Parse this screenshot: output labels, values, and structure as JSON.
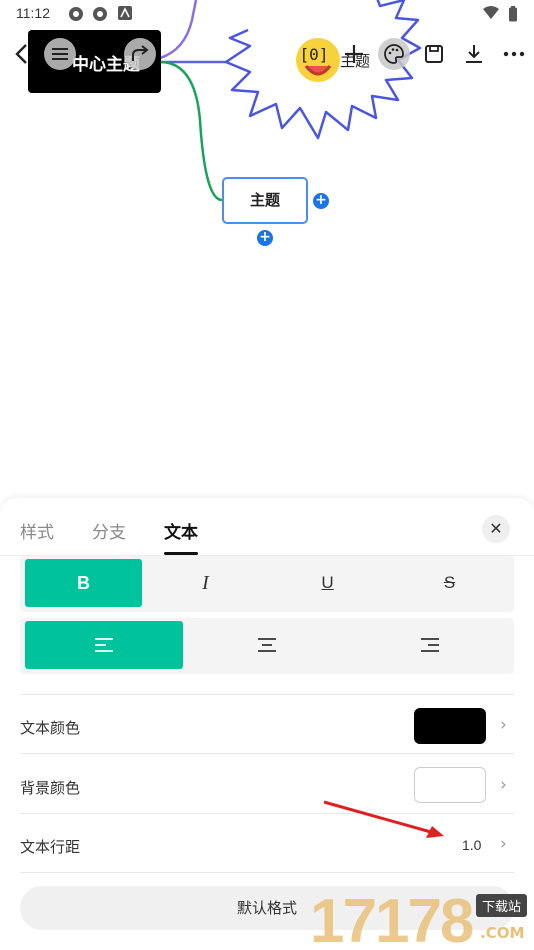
{
  "status_bar": {
    "time": "11:12"
  },
  "canvas": {
    "central_topic": "中心主题",
    "child_topic": "主题",
    "starburst_topic": "主题"
  },
  "toolbar": {
    "back_icon": "chevron-left-icon",
    "outline_icon": "list-icon",
    "redo_icon": "redo-icon",
    "formula_icon": "formula-icon",
    "formula_glyph": "[0]",
    "add_icon": "plus-icon",
    "style_icon": "palette-icon",
    "save_icon": "save-icon",
    "download_icon": "download-icon",
    "more_icon": "more-icon"
  },
  "sheet": {
    "tabs": [
      {
        "label": "样式",
        "active": false
      },
      {
        "label": "分支",
        "active": false
      },
      {
        "label": "文本",
        "active": true
      }
    ],
    "close_label": "✕",
    "format": {
      "bold": "B",
      "italic": "I",
      "underline": "U",
      "strike": "S",
      "selected": "bold"
    },
    "align": {
      "selected": "left"
    },
    "settings": {
      "text_color": {
        "label": "文本颜色",
        "value": "#000000"
      },
      "bg_color": {
        "label": "背景颜色",
        "value": "#ffffff"
      },
      "line_spacing": {
        "label": "文本行距",
        "value": "1.0"
      }
    },
    "default_button": "默认格式"
  },
  "watermark": {
    "text": "17178",
    "sub": "下载站",
    "com": ".COM"
  },
  "colors": {
    "accent": "#00c29b",
    "branch_blue": "#5a64d8",
    "branch_green": "#1aa35a",
    "arrow_red": "#e02020"
  }
}
